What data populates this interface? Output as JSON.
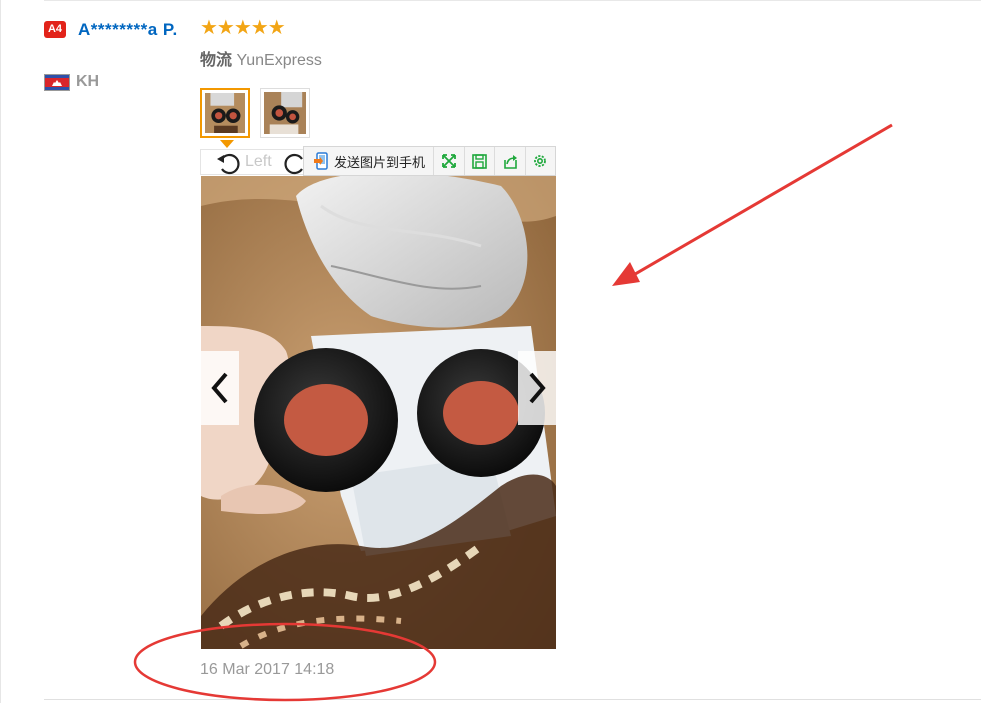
{
  "review": {
    "level_badge": "A4",
    "username": "A********a P.",
    "country": "KH",
    "rating_stars": 5,
    "rating_display": "★★★★★",
    "logistics_label": "物流",
    "logistics_value": "YunExpress",
    "rotate_left_label": "Left",
    "date": "16 Mar 2017 14:18",
    "thumbnail_count": 2
  },
  "image_toolbar": {
    "send_label": "发送图片到手机",
    "tools": [
      "expand-icon",
      "save-icon",
      "share-icon",
      "settings-icon"
    ]
  },
  "colors": {
    "username": "#0066c0",
    "badge": "#e2231a",
    "stars": "#f2a515",
    "thumb_active": "#f39800",
    "annotation": "#e53935",
    "toolbar_icons": "#1fa83c"
  }
}
